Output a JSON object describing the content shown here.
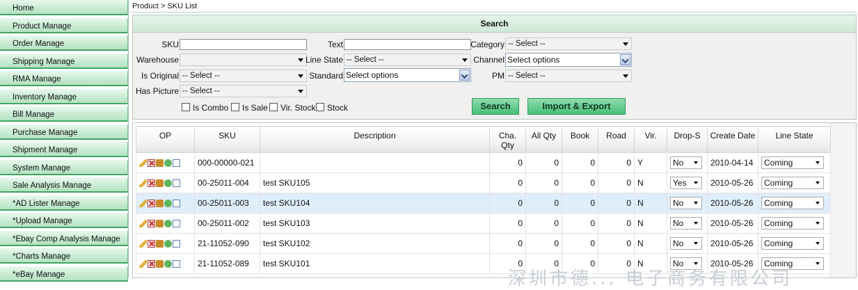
{
  "sidebar": {
    "items": [
      {
        "label": "Home"
      },
      {
        "label": "Product Manage"
      },
      {
        "label": "Order Manage"
      },
      {
        "label": "Shipping Manage"
      },
      {
        "label": "RMA Manage"
      },
      {
        "label": "Inventory Manage"
      },
      {
        "label": "Bill Manage"
      },
      {
        "label": "Purchase Manage"
      },
      {
        "label": "Shipment Manage"
      },
      {
        "label": "System Manage"
      },
      {
        "label": "Sale Analysis Manage"
      },
      {
        "label": "*AD Lister Manage"
      },
      {
        "label": "*Upload Manage"
      },
      {
        "label": "*Ebay Comp Analysis Manage"
      },
      {
        "label": "*Charts Manage"
      },
      {
        "label": "*eBay Manage"
      }
    ]
  },
  "breadcrumb": "Product > SKU List",
  "search": {
    "title": "Search",
    "sku_label": "SKU",
    "text_label": "Text",
    "category_label": "Category",
    "category_value": "-- Select --",
    "warehouse_label": "Warehouse",
    "warehouse_value": "",
    "line_state_label": "Line State",
    "line_state_value": "-- Select --",
    "channel_label": "Channel",
    "channel_value": "Select options",
    "is_original_label": "Is Original",
    "is_original_value": "-- Select --",
    "standard_label": "Standard",
    "standard_value": "Select options",
    "pm_label": "PM",
    "pm_value": "-- Select --",
    "has_picture_label": "Has Picture",
    "has_picture_value": "-- Select --",
    "checkboxes": [
      "Is Combo",
      "Is Sale",
      "Vir. Stock",
      "Stock"
    ],
    "search_button": "Search",
    "import_export_button": "Import & Export"
  },
  "table": {
    "headers": [
      "OP",
      "SKU",
      "Description",
      "Cha. Qty",
      "All Qty",
      "Book",
      "Road",
      "Vir.",
      "Drop-S",
      "Create Date",
      "Line State"
    ],
    "rows": [
      {
        "sku": "000-00000-021",
        "desc": "",
        "cha": "0",
        "all": "0",
        "book": "0",
        "road": "0",
        "vir": "Y",
        "drop": "No",
        "date": "2010-04-14",
        "state": "Coming"
      },
      {
        "sku": "00-25011-004",
        "desc": "test SKU105",
        "cha": "0",
        "all": "0",
        "book": "0",
        "road": "0",
        "vir": "N",
        "drop": "Yes",
        "date": "2010-05-26",
        "state": "Coming"
      },
      {
        "sku": "00-25011-003",
        "desc": "test SKU104",
        "cha": "0",
        "all": "0",
        "book": "0",
        "road": "0",
        "vir": "N",
        "drop": "No",
        "date": "2010-05-26",
        "state": "Coming"
      },
      {
        "sku": "00-25011-002",
        "desc": "test SKU103",
        "cha": "0",
        "all": "0",
        "book": "0",
        "road": "0",
        "vir": "N",
        "drop": "No",
        "date": "2010-05-26",
        "state": "Coming"
      },
      {
        "sku": "21-11052-090",
        "desc": "test SKU102",
        "cha": "0",
        "all": "0",
        "book": "0",
        "road": "0",
        "vir": "N",
        "drop": "No",
        "date": "2010-05-26",
        "state": "Coming"
      },
      {
        "sku": "21-11052-089",
        "desc": "test SKU101",
        "cha": "0",
        "all": "0",
        "book": "0",
        "road": "0",
        "vir": "N",
        "drop": "No",
        "date": "2010-05-26",
        "state": "Coming"
      }
    ],
    "highlighted_row": 2
  },
  "watermark": "深圳市德... 电子商务有限公司",
  "colors": {
    "nav_green": "#c9ecd3",
    "button_green": "#48c07a",
    "row_highlight": "#dfeefa"
  },
  "icons": [
    "edit-icon",
    "delete-icon",
    "package-icon",
    "search-icon",
    "document-icon"
  ]
}
